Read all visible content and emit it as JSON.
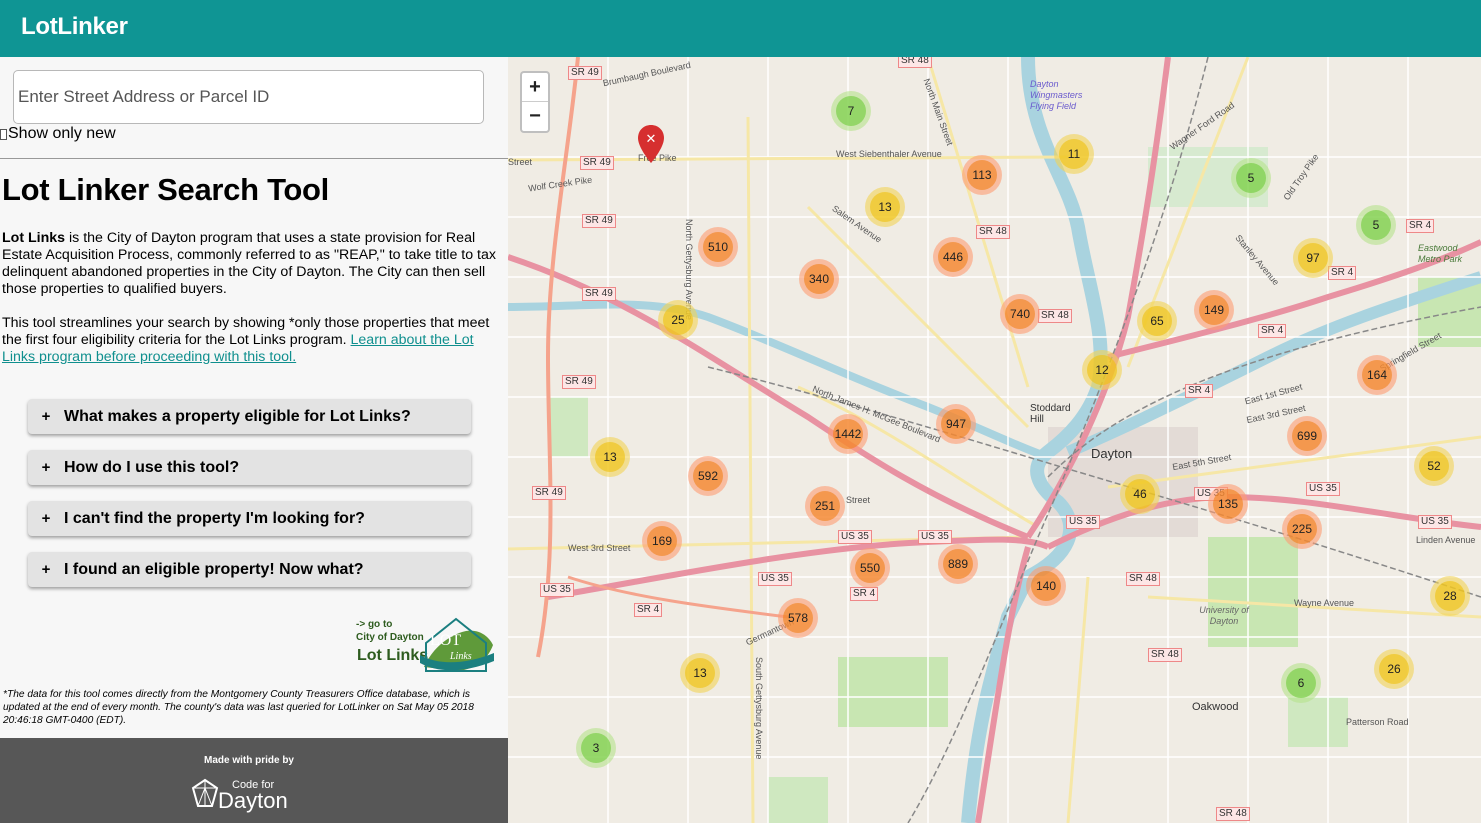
{
  "app": {
    "brand": "LotLinker"
  },
  "search": {
    "placeholder": "Enter Street Address or Parcel ID",
    "value": ""
  },
  "filter": {
    "show_new_label": "Show only new"
  },
  "intro": {
    "title": "Lot Linker Search Tool",
    "lead_bold": "Lot Links",
    "lead_rest": " is the City of Dayton program that uses a state provision for Real Estate Acquisition Process, commonly referred to as \"REAP,\" to take title to tax delinquent abandoned properties in the City of Dayton. The City can then sell those properties to qualified buyers.",
    "para2_text": "This tool streamlines your search by showing *only those properties that meet the first four eligibility criteria for the Lot Links program. ",
    "para2_link": "Learn about the Lot Links program before proceeding with this tool."
  },
  "faq": [
    {
      "label": "What makes a property eligible for Lot Links?"
    },
    {
      "label": "How do I use this tool?"
    },
    {
      "label": "I can't find the property I'm looking for?"
    },
    {
      "label": "I found an eligible property! Now what?"
    }
  ],
  "faq_plus": "+",
  "lot_logo": {
    "goto_line1": "-> go to",
    "goto_line2": "City of Dayton",
    "lot_links": "Lot Links",
    "badge_big": "LOT",
    "badge_small": "Links"
  },
  "footnote": "*The data for this tool comes directly from the Montgomery County Treasurers Office database, which is updated at the end of every month. The county's data was last queried for LotLinker on Sat May 05 2018 20:46:18 GMT-0400 (EDT).",
  "footer": {
    "made_with": "Made with pride by",
    "cfd_small": "Code for",
    "cfd_big": "Dayton"
  },
  "map": {
    "zoom_in": "+",
    "zoom_out": "−",
    "marker_glyph": "✕",
    "city_labels": [
      "Dayton",
      "Oakwood",
      "Stoddard Hill"
    ],
    "clusters": [
      {
        "count": "7",
        "tier": "green"
      },
      {
        "count": "11",
        "tier": "yellow"
      },
      {
        "count": "113",
        "tier": "orange"
      },
      {
        "count": "5",
        "tier": "green"
      },
      {
        "count": "13",
        "tier": "yellow"
      },
      {
        "count": "510",
        "tier": "orange"
      },
      {
        "count": "446",
        "tier": "orange"
      },
      {
        "count": "5",
        "tier": "green"
      },
      {
        "count": "97",
        "tier": "yellow"
      },
      {
        "count": "340",
        "tier": "orange"
      },
      {
        "count": "25",
        "tier": "yellow"
      },
      {
        "count": "740",
        "tier": "orange"
      },
      {
        "count": "65",
        "tier": "yellow"
      },
      {
        "count": "149",
        "tier": "orange"
      },
      {
        "count": "12",
        "tier": "yellow"
      },
      {
        "count": "164",
        "tier": "orange"
      },
      {
        "count": "947",
        "tier": "orange"
      },
      {
        "count": "1442",
        "tier": "orange"
      },
      {
        "count": "699",
        "tier": "orange"
      },
      {
        "count": "13",
        "tier": "yellow"
      },
      {
        "count": "592",
        "tier": "orange"
      },
      {
        "count": "52",
        "tier": "yellow"
      },
      {
        "count": "46",
        "tier": "yellow"
      },
      {
        "count": "251",
        "tier": "orange"
      },
      {
        "count": "135",
        "tier": "orange"
      },
      {
        "count": "225",
        "tier": "orange"
      },
      {
        "count": "169",
        "tier": "orange"
      },
      {
        "count": "550",
        "tier": "orange"
      },
      {
        "count": "889",
        "tier": "orange"
      },
      {
        "count": "140",
        "tier": "orange"
      },
      {
        "count": "578",
        "tier": "orange"
      },
      {
        "count": "28",
        "tier": "yellow"
      },
      {
        "count": "13",
        "tier": "yellow"
      },
      {
        "count": "26",
        "tier": "yellow"
      },
      {
        "count": "6",
        "tier": "green"
      },
      {
        "count": "3",
        "tier": "green"
      }
    ],
    "street_labels": [
      "SR 49",
      "SR 49",
      "SR 49",
      "SR 49",
      "SR 49",
      "SR 49",
      "SR 48",
      "SR 48",
      "SR 48",
      "SR 48",
      "SR 48",
      "SR 4",
      "SR 4",
      "SR 4",
      "SR 4",
      "SR 4",
      "US 35",
      "US 35",
      "US 35",
      "US 35",
      "US 35",
      "US 35",
      "US 35",
      "US 35",
      "West Siebenthaler Avenue",
      "Salem Avenue",
      "North Main Street",
      "West 3rd Street",
      "East 3rd Street",
      "East 5th Street",
      "Wayne Avenue",
      "Germantown",
      "Brumbaugh Boulevard",
      "Wolf Creek Pike",
      "Free Pike",
      "East 1st Street",
      "Springfield Street",
      "Stanley Avenue",
      "Old Troy Pike",
      "Wagner Ford Road",
      "Linden Avenue",
      "Patterson Road",
      "Dayton Wingmasters Flying Field",
      "Eastwood Metro Park",
      "University of Dayton",
      "Street",
      "Street",
      "North James H. McGee Boulevard",
      "North Gettysburg Avenue",
      "South Gettysburg Avenue"
    ]
  }
}
